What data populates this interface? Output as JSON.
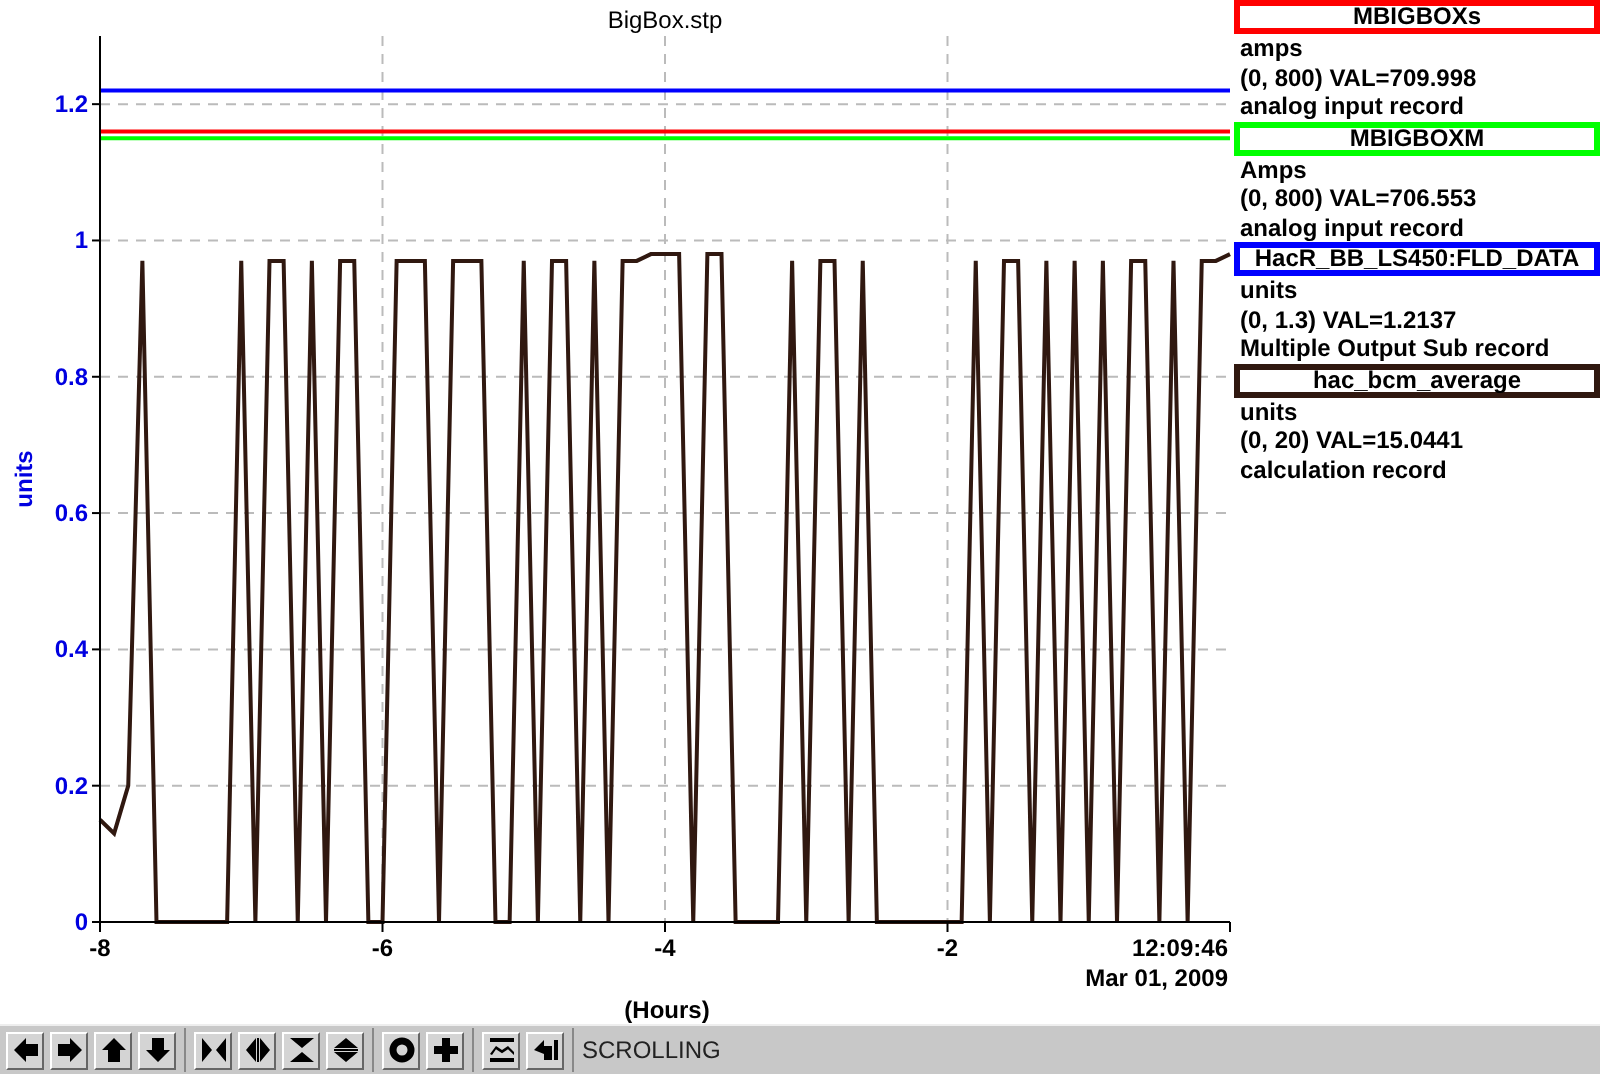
{
  "chart": {
    "title": "BigBox.stp",
    "time": "12:09:46",
    "date": "Mar 01, 2009",
    "chart_data": {
      "type": "line",
      "xlabel": "(Hours)",
      "ylabel": "units",
      "xlim": [
        -8,
        0
      ],
      "ylim": [
        0,
        1.3
      ],
      "grid": true,
      "xticks": [
        -8,
        -6,
        -4,
        -2
      ],
      "yticks": [
        0,
        0.2,
        0.4,
        0.6,
        0.8,
        1,
        1.2
      ],
      "x": [
        -8,
        -7.9,
        -7.8,
        -7.7,
        -7.6,
        -7.5,
        -7.4,
        -7.3,
        -7.2,
        -7.1,
        -7,
        -6.9,
        -6.8,
        -6.7,
        -6.6,
        -6.5,
        -6.4,
        -6.3,
        -6.2,
        -6.1,
        -6,
        -5.9,
        -5.8,
        -5.7,
        -5.6,
        -5.5,
        -5.4,
        -5.3,
        -5.2,
        -5.1,
        -5,
        -4.9,
        -4.8,
        -4.7,
        -4.6,
        -4.5,
        -4.4,
        -4.3,
        -4.2,
        -4.1,
        -4,
        -3.9,
        -3.8,
        -3.7,
        -3.6,
        -3.5,
        -3.4,
        -3.3,
        -3.2,
        -3.1,
        -3,
        -2.9,
        -2.8,
        -2.7,
        -2.6,
        -2.5,
        -2.4,
        -2.3,
        -2.2,
        -2.1,
        -2,
        -1.9,
        -1.8,
        -1.7,
        -1.6,
        -1.5,
        -1.4,
        -1.3,
        -1.2,
        -1.1,
        -1,
        -0.9,
        -0.8,
        -0.7,
        -0.6,
        -0.5,
        -0.4,
        -0.3,
        -0.2,
        -0.1,
        0
      ],
      "series": [
        {
          "name": "MBIGBOXs",
          "color": "#ff0000",
          "values": [
            1.16,
            1.16,
            1.16,
            1.16,
            1.16,
            1.16,
            1.16,
            1.16,
            1.16,
            1.16,
            1.16,
            1.16,
            1.16,
            1.16,
            1.16,
            1.16,
            1.16,
            1.16,
            1.16,
            1.16,
            1.16,
            1.16,
            1.16,
            1.16,
            1.16,
            1.16,
            1.16,
            1.16,
            1.16,
            1.16,
            1.16,
            1.16,
            1.16,
            1.16,
            1.16,
            1.16,
            1.16,
            1.16,
            1.16,
            1.16,
            1.16,
            1.16,
            1.16,
            1.16,
            1.16,
            1.16,
            1.16,
            1.16,
            1.16,
            1.16,
            1.16,
            1.16,
            1.16,
            1.16,
            1.16,
            1.16,
            1.16,
            1.16,
            1.16,
            1.16,
            1.16,
            1.16,
            1.16,
            1.16,
            1.16,
            1.16,
            1.16,
            1.16,
            1.16,
            1.16,
            1.16,
            1.16,
            1.16,
            1.16,
            1.16,
            1.16,
            1.16,
            1.16,
            1.16,
            1.16,
            1.16
          ]
        },
        {
          "name": "MBIGBOXM",
          "color": "#00ff00",
          "values": [
            1.15,
            1.15,
            1.15,
            1.15,
            1.15,
            1.15,
            1.15,
            1.15,
            1.15,
            1.15,
            1.15,
            1.15,
            1.15,
            1.15,
            1.15,
            1.15,
            1.15,
            1.15,
            1.15,
            1.15,
            1.15,
            1.15,
            1.15,
            1.15,
            1.15,
            1.15,
            1.15,
            1.15,
            1.15,
            1.15,
            1.15,
            1.15,
            1.15,
            1.15,
            1.15,
            1.15,
            1.15,
            1.15,
            1.15,
            1.15,
            1.15,
            1.15,
            1.15,
            1.15,
            1.15,
            1.15,
            1.15,
            1.15,
            1.15,
            1.15,
            1.15,
            1.15,
            1.15,
            1.15,
            1.15,
            1.15,
            1.15,
            1.15,
            1.15,
            1.15,
            1.15,
            1.15,
            1.15,
            1.15,
            1.15,
            1.15,
            1.15,
            1.15,
            1.15,
            1.15,
            1.15,
            1.15,
            1.15,
            1.15,
            1.15,
            1.15,
            1.15,
            1.15,
            1.15,
            1.15,
            1.15
          ]
        },
        {
          "name": "HacR_BB_LS450:FLD_DATA",
          "color": "#0000ff",
          "values": [
            1.22,
            1.22,
            1.22,
            1.22,
            1.22,
            1.22,
            1.22,
            1.22,
            1.22,
            1.22,
            1.22,
            1.22,
            1.22,
            1.22,
            1.22,
            1.22,
            1.22,
            1.22,
            1.22,
            1.22,
            1.22,
            1.22,
            1.22,
            1.22,
            1.22,
            1.22,
            1.22,
            1.22,
            1.22,
            1.22,
            1.22,
            1.22,
            1.22,
            1.22,
            1.22,
            1.22,
            1.22,
            1.22,
            1.22,
            1.22,
            1.22,
            1.22,
            1.22,
            1.22,
            1.22,
            1.22,
            1.22,
            1.22,
            1.22,
            1.22,
            1.22,
            1.22,
            1.22,
            1.22,
            1.22,
            1.22,
            1.22,
            1.22,
            1.22,
            1.22,
            1.22,
            1.22,
            1.22,
            1.22,
            1.22,
            1.22,
            1.22,
            1.22,
            1.22,
            1.22,
            1.22,
            1.22,
            1.22,
            1.22,
            1.22,
            1.22,
            1.22,
            1.22,
            1.22,
            1.22,
            1.22
          ]
        },
        {
          "name": "hac_bcm_average",
          "color": "#301810",
          "values": [
            0.15,
            0.13,
            0.2,
            0.97,
            0,
            0,
            0,
            0,
            0,
            0,
            0.97,
            0,
            0.97,
            0.97,
            0,
            0.97,
            0,
            0.97,
            0.97,
            0,
            0,
            0.97,
            0.97,
            0.97,
            0,
            0.97,
            0.97,
            0.97,
            0,
            0,
            0.97,
            0,
            0.97,
            0.97,
            0,
            0.97,
            0,
            0.97,
            0.97,
            0.98,
            0.98,
            0.98,
            0,
            0.98,
            0.98,
            0,
            0,
            0,
            0,
            0.97,
            0,
            0.97,
            0.97,
            0,
            0.97,
            0,
            0,
            0,
            0,
            0,
            0,
            0,
            0.97,
            0,
            0.97,
            0.97,
            0,
            0.97,
            0,
            0.97,
            0,
            0.97,
            0,
            0.97,
            0.97,
            0,
            0.97,
            0,
            0.97,
            0.97,
            0.98
          ]
        }
      ]
    }
  },
  "legend": [
    {
      "units": "amps",
      "range": "(0, 800) VAL=709.998",
      "record": "analog input record"
    },
    {
      "units": "Amps",
      "range": "(0, 800) VAL=706.553",
      "record": "analog input record"
    },
    {
      "units": "units",
      "range": "(0, 1.3) VAL=1.2137",
      "record": "Multiple Output Sub record"
    },
    {
      "units": "units",
      "range": "(0, 20) VAL=15.0441",
      "record": "calculation record"
    }
  ],
  "toolbar": {
    "groups": [
      [
        {
          "kind": "left"
        },
        {
          "kind": "right"
        },
        {
          "kind": "up"
        },
        {
          "kind": "down"
        }
      ],
      [
        {
          "kind": "zoom-in-x"
        },
        {
          "kind": "zoom-out-x"
        },
        {
          "kind": "zoom-in-y"
        },
        {
          "kind": "zoom-out-y"
        }
      ],
      [
        {
          "kind": "ring"
        },
        {
          "kind": "plus"
        }
      ],
      [
        {
          "kind": "graph"
        },
        {
          "kind": "back"
        }
      ]
    ],
    "status": "SCROLLING"
  }
}
